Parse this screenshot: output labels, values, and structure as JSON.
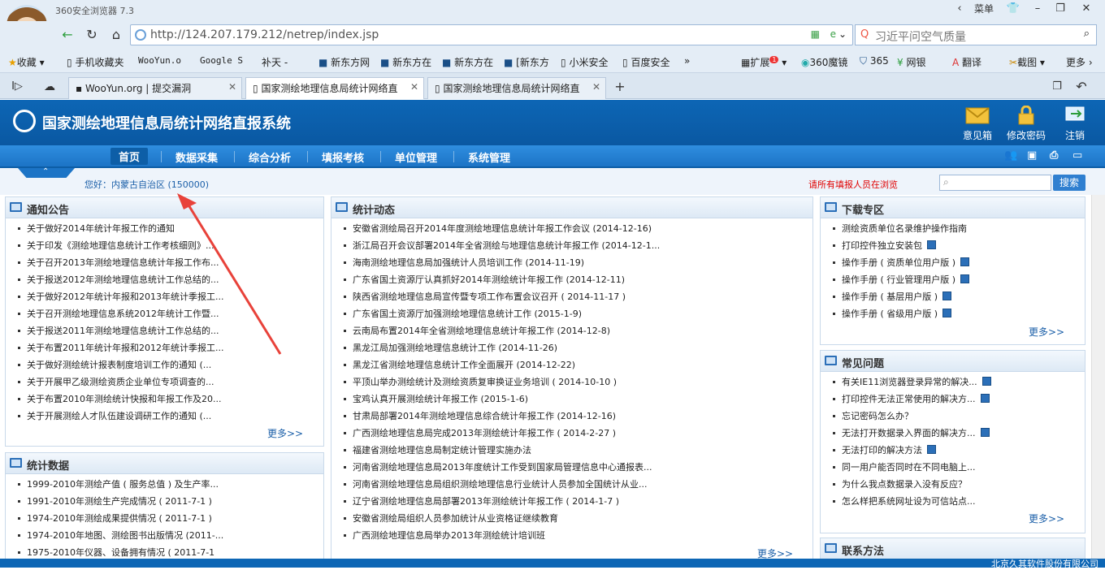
{
  "browser": {
    "app_title": "360安全浏览器 7.3",
    "window_buttons": [
      "菜单"
    ],
    "url": "http://124.207.179.212/netrep/index.jsp",
    "search_placeholder": "习近平问空气质量",
    "favorites": [
      "收藏",
      "手机收藏夹",
      "WooYun.o",
      "Google S",
      "补天 -",
      "新东方网",
      "新东方在",
      "新东方在",
      "[新东方",
      "小米安全",
      "百度安全",
      "扩展",
      "360魔镜",
      "365",
      "网银",
      "翻译",
      "截图",
      "更多"
    ],
    "extension_badge": "1",
    "tabs": [
      {
        "title": "WooYun.org | 提交漏洞",
        "active": false
      },
      {
        "title": "国家测绘地理信息局统计网络直",
        "active": true
      },
      {
        "title": "国家测绘地理信息局统计网络直",
        "active": false
      }
    ]
  },
  "site": {
    "title": "国家测绘地理信息局统计网络直报系统",
    "header_buttons": [
      "意见箱",
      "修改密码",
      "注销"
    ],
    "nav": [
      "首页",
      "数据采集",
      "综合分析",
      "填报考核",
      "单位管理",
      "系统管理"
    ],
    "welcome": "您好：内蒙古自治区 (150000)",
    "notice": "请所有填报人员在浏览",
    "search_button": "搜索",
    "footer": "北京久其软件股份有限公司"
  },
  "panels": {
    "notices": {
      "title": "通知公告",
      "more": "更多>>",
      "items": [
        "关于做好2014年统计年报工作的通知",
        "关于印发《测绘地理信息统计工作考核细则》...",
        "关于召开2013年测绘地理信息统计年报工作布...",
        "关于报送2012年测绘地理信息统计工作总结的...",
        "关于做好2012年统计年报和2013年统计季报工...",
        "关于召开测绘地理信息系统2012年统计工作暨...",
        "关于报送2011年测绘地理信息统计工作总结的...",
        "关于布置2011年统计年报和2012年统计季报工...",
        "关于做好测绘统计报表制度培训工作的通知 (...",
        "关于开展甲乙级测绘资质企业单位专项调查的...",
        "关于布置2010年测绘统计快报和年报工作及20...",
        "关于开展测绘人才队伍建设调研工作的通知 (..."
      ]
    },
    "stats_data": {
      "title": "统计数据",
      "items": [
        "1999-2010年测绘产值 ( 服务总值 ) 及生产率...",
        "1991-2010年测绘生产完成情况 ( 2011-7-1 )",
        "1974-2010年测绘成果提供情况 ( 2011-7-1 )",
        "1974-2010年地图、测绘图书出版情况 (2011-...",
        "1975-2010年仪器、设备拥有情况 ( 2011-7-1"
      ]
    },
    "stats_news": {
      "title": "统计动态",
      "more": "更多>>",
      "items": [
        "安徽省测绘局召开2014年度测绘地理信息统计年报工作会议 (2014-12-16)",
        "浙江局召开会议部署2014年全省测绘与地理信息统计年报工作 (2014-12-1...",
        "海南测绘地理信息局加强统计人员培训工作 (2014-11-19)",
        "广东省国土资源厅认真抓好2014年测绘统计年报工作 (2014-12-11)",
        "陕西省测绘地理信息局宣传暨专项工作布置会议召开 ( 2014-11-17 )",
        "广东省国土资源厅加强测绘地理信息统计工作 (2015-1-9)",
        "云南局布置2014年全省测绘地理信息统计年报工作 (2014-12-8)",
        "黑龙江局加强测绘地理信息统计工作 (2014-11-26)",
        "黑龙江省测绘地理信息统计工作全面展开 (2014-12-22)",
        "平顶山举办测绘统计及测绘资质复审换证业务培训 ( 2014-10-10 )",
        "宝鸡认真开展测绘统计年报工作 (2015-1-6)",
        "甘肃局部署2014年测绘地理信息综合统计年报工作 (2014-12-16)",
        "广西测绘地理信息局完成2013年测绘统计年报工作 ( 2014-2-27 )",
        "福建省测绘地理信息局制定统计管理实施办法",
        "河南省测绘地理信息局2013年度统计工作受到国家局管理信息中心通报表...",
        "河南省测绘地理信息局组织测绘地理信息行业统计人员参加全国统计从业...",
        "辽宁省测绘地理信息局部署2013年测绘统计年报工作 ( 2014-1-7 )",
        "安徽省测绘局组织人员参加统计从业资格证继续教育",
        "广西测绘地理信息局举办2013年测绘统计培训班"
      ]
    },
    "downloads": {
      "title": "下载专区",
      "more": "更多>>",
      "items": [
        {
          "text": "测绘资质单位名录维护操作指南",
          "disk": false
        },
        {
          "text": "打印控件独立安装包",
          "disk": true
        },
        {
          "text": "操作手册 ( 资质单位用户版 )",
          "disk": true
        },
        {
          "text": "操作手册 ( 行业管理用户版 )",
          "disk": true
        },
        {
          "text": "操作手册 ( 基层用户版 )",
          "disk": true
        },
        {
          "text": "操作手册 ( 省级用户版 )",
          "disk": true
        }
      ]
    },
    "faq": {
      "title": "常见问题",
      "more": "更多>>",
      "items": [
        {
          "text": "有关IE11浏览器登录异常的解决...",
          "disk": true
        },
        {
          "text": "打印控件无法正常使用的解决方...",
          "disk": true
        },
        {
          "text": "忘记密码怎么办？",
          "disk": false
        },
        {
          "text": "无法打开数据录入界面的解决方...",
          "disk": true
        },
        {
          "text": "无法打印的解决方法",
          "disk": true
        },
        {
          "text": "同一用户能否同时在不同电脑上...",
          "disk": false
        },
        {
          "text": "为什么我点数据录入没有反应？",
          "disk": false
        },
        {
          "text": "怎么样把系统网址设为可信站点...",
          "disk": false
        }
      ]
    },
    "contact": {
      "title": "联系方法"
    }
  },
  "colors": {
    "brand_blue": "#0d66b5",
    "nav_blue": "#2f8ee0",
    "notice_red": "#e00000",
    "annotation_arrow": "#e8423a"
  }
}
